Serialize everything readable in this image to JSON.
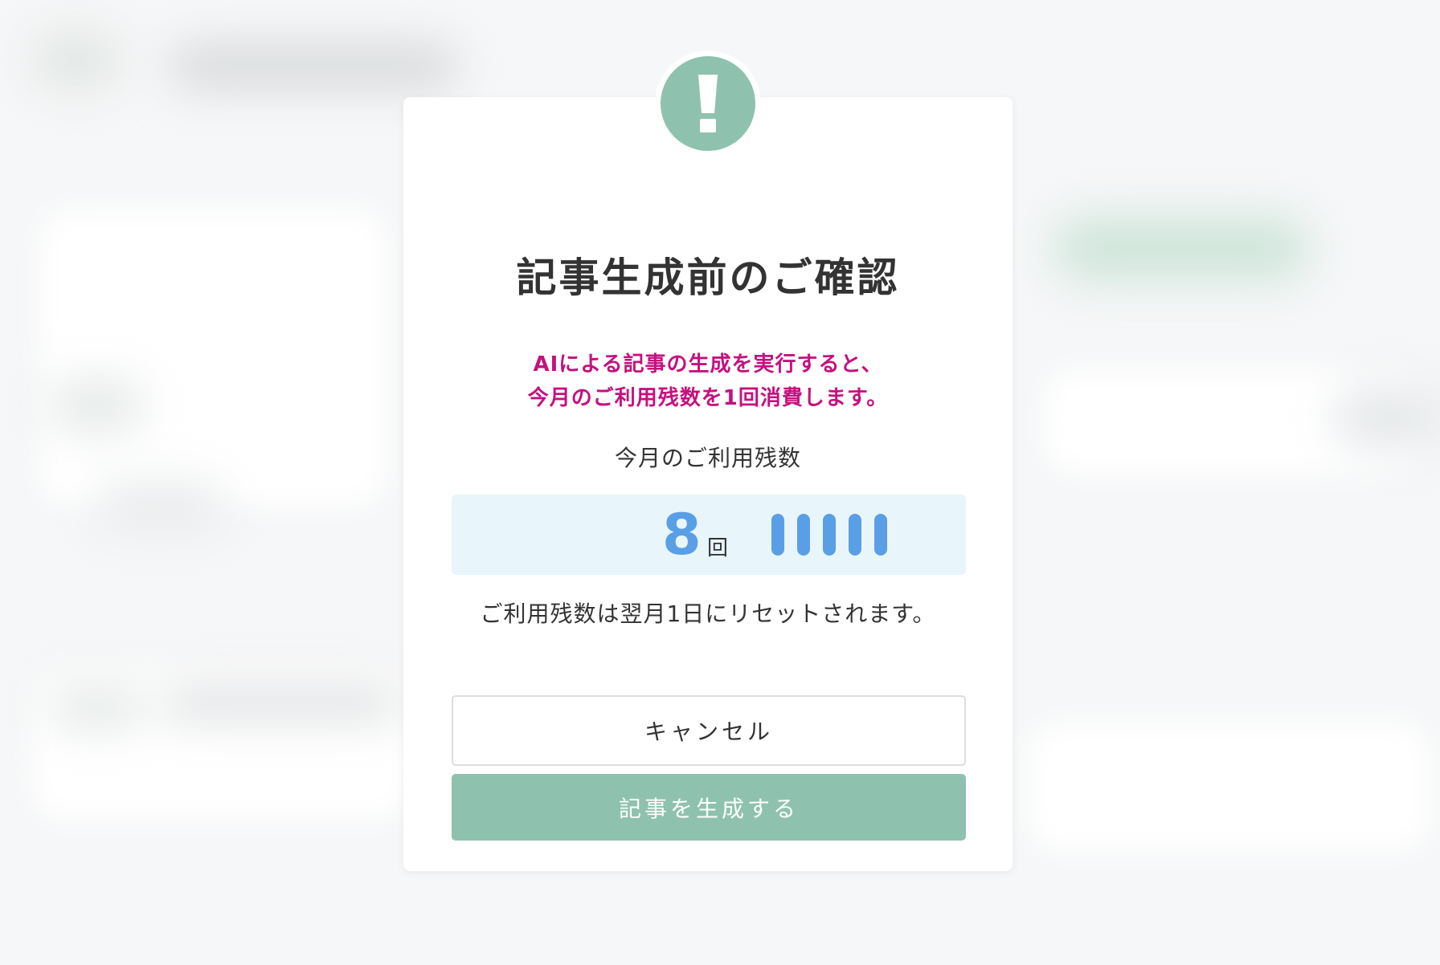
{
  "dialog": {
    "icon": "exclamation-icon",
    "title": "記事生成前のご確認",
    "warning_line1": "AIによる記事の生成を実行すると、",
    "warning_line2": "今月のご利用残数を1回消費します。",
    "remaining_label": "今月のご利用残数",
    "remaining_count": "8",
    "remaining_unit": "回",
    "remaining_bars": 5,
    "reset_note": "ご利用残数は翌月1日にリセットされます。",
    "cancel_label": "キャンセル",
    "generate_label": "記事を生成する"
  },
  "colors": {
    "accent": "#8fc2ae",
    "warning_text": "#c5117f",
    "counter_blue": "#5a9fe5",
    "counter_bg": "#e8f5fb"
  }
}
